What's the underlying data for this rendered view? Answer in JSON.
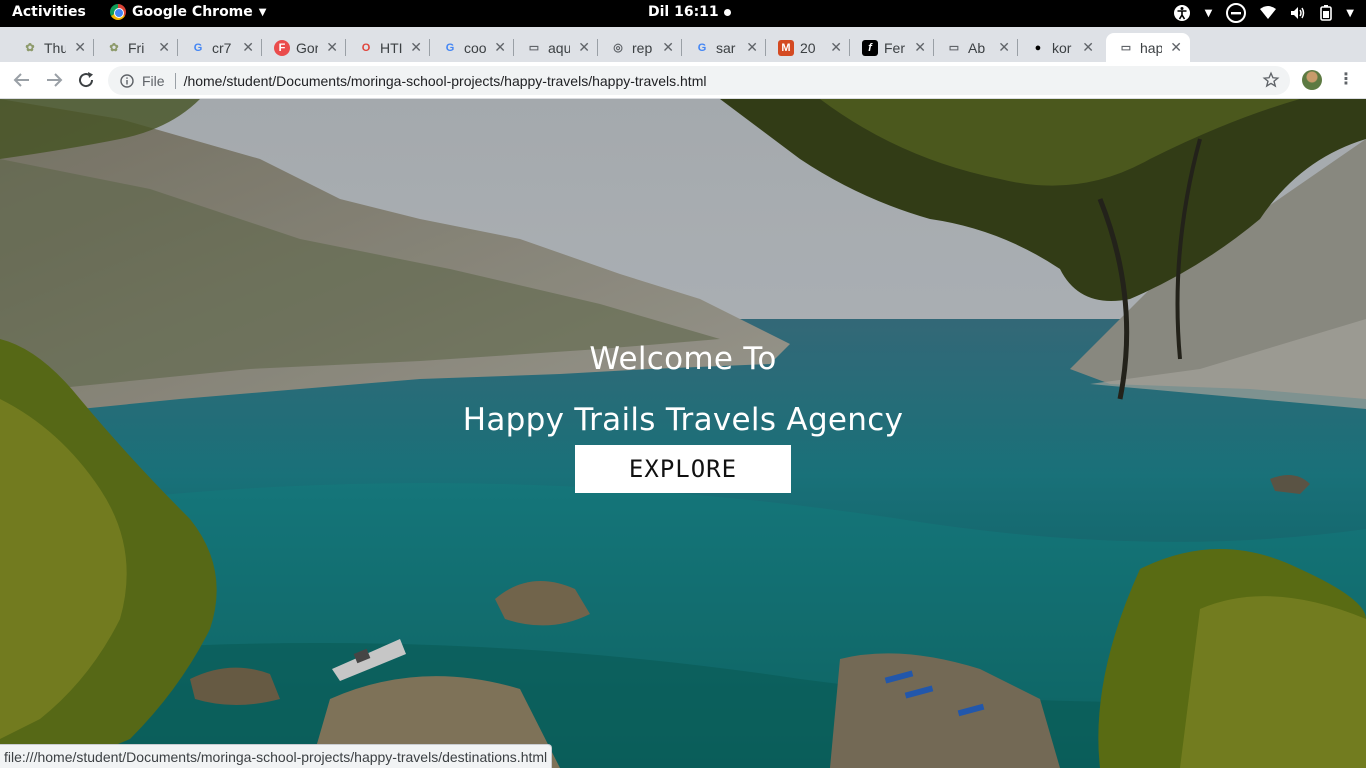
{
  "topbar": {
    "activities": "Activities",
    "app_name": "Google Chrome",
    "clock": "Dil 16:11"
  },
  "tabs": [
    {
      "title": "Thu",
      "icon": "tree-icon",
      "color": "#8d9a6b"
    },
    {
      "title": "Fri",
      "icon": "tree-icon",
      "color": "#8d9a6b"
    },
    {
      "title": "cr7",
      "icon": "google-icon",
      "color": "#4285f4"
    },
    {
      "title": "Gor",
      "icon": "f-badge-icon",
      "color": "#ea4c4c"
    },
    {
      "title": "HTI",
      "icon": "opera-ring-icon",
      "color": "#e0433a"
    },
    {
      "title": "coo",
      "icon": "google-icon",
      "color": "#4285f4"
    },
    {
      "title": "aqu",
      "icon": "document-icon",
      "color": "#5f6368"
    },
    {
      "title": "rep",
      "icon": "spiral-icon",
      "color": "#5f6368"
    },
    {
      "title": "sar",
      "icon": "google-icon",
      "color": "#4285f4"
    },
    {
      "title": "20",
      "icon": "m-badge-icon",
      "color": "#d44a22"
    },
    {
      "title": "Fer",
      "icon": "f-italic-icon",
      "color": "#000000"
    },
    {
      "title": "Ab",
      "icon": "document-icon",
      "color": "#5f6368"
    },
    {
      "title": "kor",
      "icon": "github-icon",
      "color": "#000000"
    },
    {
      "title": "hap",
      "icon": "document-icon",
      "color": "#5f6368",
      "active": true
    }
  ],
  "toolbar": {
    "scheme_label": "File",
    "url": "/home/student/Documents/moringa-school-projects/happy-travels/happy-travels.html"
  },
  "hero": {
    "title_line_1": "Welcome To",
    "title_line_2": "Happy Trails Travels Agency",
    "button_label": "EXPLORE"
  },
  "status_bar": {
    "link_url": "file:///home/student/Documents/moringa-school-projects/happy-travels/destinations.html"
  },
  "colors": {
    "tabstrip_bg": "#dee1e6",
    "omnibox_bg": "#f1f3f4",
    "sea_teal": "#1f8a94",
    "button_bg": "#ffffff"
  }
}
